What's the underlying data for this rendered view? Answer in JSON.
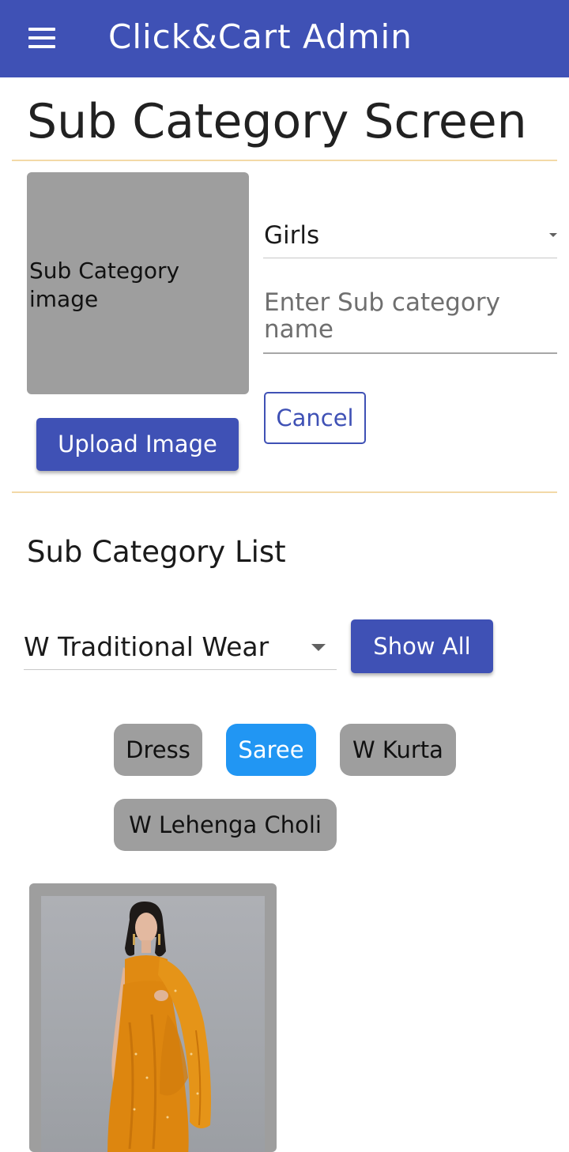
{
  "app": {
    "title": "Click&Cart Admin"
  },
  "page": {
    "title": "Sub Category Screen"
  },
  "form": {
    "image_placeholder": "Sub Category image",
    "upload_label": "Upload Image",
    "category_value": "Girls",
    "name_placeholder": "Enter Sub category name",
    "cancel_label": "Cancel"
  },
  "list": {
    "title": "Sub Category List",
    "filter_value": "W Traditional Wear",
    "show_all_label": "Show All",
    "chips": [
      {
        "label": "Dress",
        "selected": false
      },
      {
        "label": "Saree",
        "selected": true
      },
      {
        "label": "W Kurta",
        "selected": false
      },
      {
        "label": "W Lehenga Choli",
        "selected": false
      }
    ]
  },
  "colors": {
    "primary": "#3f51b5",
    "chip_selected": "#2196f3",
    "chip_default": "#9e9e9e",
    "divider": "#f3d9a7",
    "saree": "#e08a12"
  },
  "icons": {
    "menu": "menu-icon",
    "dropdown": "chevron-down-icon"
  }
}
